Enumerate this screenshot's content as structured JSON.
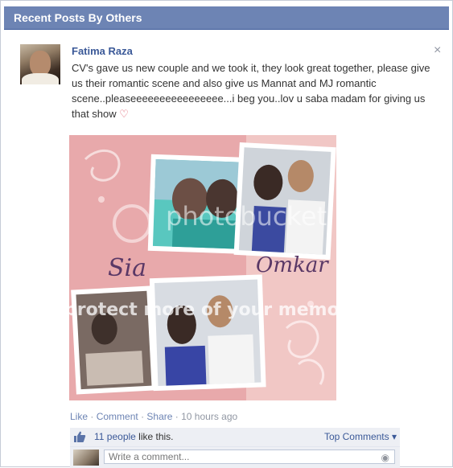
{
  "header": {
    "title": "Recent Posts By Others"
  },
  "post": {
    "author": "Fatima Raza",
    "text": "CV's gave us new couple and we took it, they look great together, please give us their romantic scene and also give us Mannat and MJ romantic scene..pleaseeeeeeeeeeeeeeee...i beg you..lov u saba madam for giving us that show",
    "close_symbol": "×",
    "heart_symbol": "♡"
  },
  "photo": {
    "name_left": "Sia",
    "name_right": "Omkar",
    "watermark": "photobucket",
    "banner": "protect more of your memories",
    "colors": {
      "pink": "#e9aeb0",
      "teal": "#3fb8b0"
    }
  },
  "actions": {
    "like": "Like",
    "comment": "Comment",
    "share": "Share",
    "timestamp": "10 hours ago",
    "separator": "·"
  },
  "likes": {
    "count_text": "11 people",
    "suffix": "like this.",
    "top_comments": "Top Comments ▾"
  },
  "comment_box": {
    "placeholder": "Write a comment..."
  },
  "theme": {
    "header_bg": "#6d84b4",
    "link": "#3b5998"
  }
}
